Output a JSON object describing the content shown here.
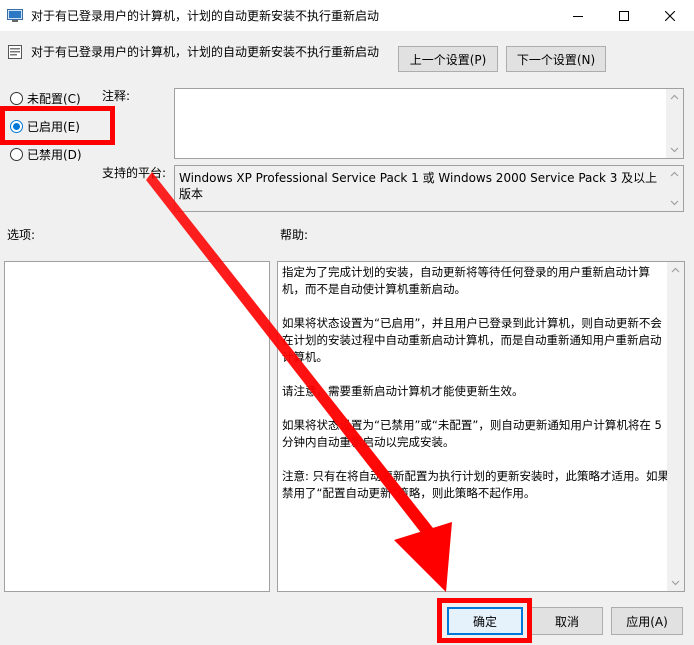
{
  "window": {
    "title": "对于有已登录用户的计算机，计划的自动更新安装不执行重新启动",
    "min_icon": "minimize-icon",
    "max_icon": "maximize-icon",
    "close_icon": "close-icon"
  },
  "header": {
    "title": "对于有已登录用户的计算机，计划的自动更新安装不执行重新启动",
    "prev_label": "上一个设置(P)",
    "next_label": "下一个设置(N)"
  },
  "state": {
    "not_configured_label": "未配置(C)",
    "enabled_label": "已启用(E)",
    "disabled_label": "已禁用(D)",
    "selected": "enabled"
  },
  "labels": {
    "comment": "注释:",
    "platform": "支持的平台:",
    "options": "选项:",
    "help": "帮助:"
  },
  "fields": {
    "comment_value": "",
    "platform_value": "Windows XP Professional Service Pack 1 或 Windows 2000 Service Pack 3 及以上版本"
  },
  "help": {
    "p1": "指定为了完成计划的安装，自动更新将等待任何登录的用户重新启动计算机，而不是自动使计算机重新启动。",
    "p2": "如果将状态设置为“已启用”，并且用户已登录到此计算机，则自动更新不会在计划的安装过程中自动重新启动计算机，而是自动重新通知用户重新启动计算机。",
    "p3": "请注意，需要重新启动计算机才能使更新生效。",
    "p4": "如果将状态设置为“已禁用”或“未配置”，则自动更新通知用户计算机将在 5 分钟内自动重新启动以完成安装。",
    "p5": "注意: 只有在将自动更新配置为执行计划的更新安装时，此策略才适用。如果禁用了“配置自动更新”策略，则此策略不起作用。"
  },
  "footer": {
    "ok_label": "确定",
    "cancel_label": "取消",
    "apply_label": "应用(A)"
  },
  "colors": {
    "annotation": "#ff0000",
    "accent": "#0078d7"
  }
}
